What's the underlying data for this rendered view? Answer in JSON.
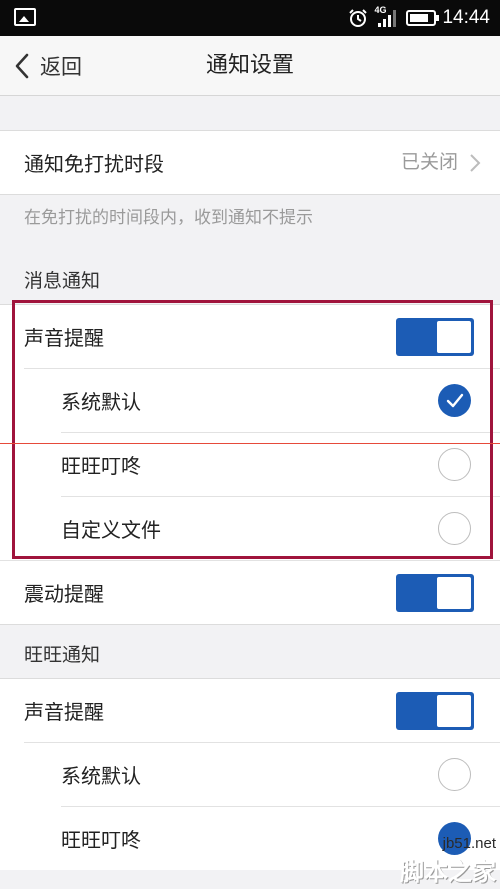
{
  "status_bar": {
    "time": "14:44",
    "network": "4G"
  },
  "nav": {
    "back_label": "返回",
    "title": "通知设置"
  },
  "dnd": {
    "label": "通知免打扰时段",
    "value": "已关闭",
    "note": "在免打扰的时间段内，收到通知不提示"
  },
  "message_section": {
    "header": "消息通知",
    "sound": {
      "label": "声音提醒",
      "on": true
    },
    "options": [
      {
        "label": "系统默认",
        "selected": true
      },
      {
        "label": "旺旺叮咚",
        "selected": false
      },
      {
        "label": "自定义文件",
        "selected": false
      }
    ],
    "vibrate": {
      "label": "震动提醒",
      "on": true
    }
  },
  "wangwang_section": {
    "header": "旺旺通知",
    "sound": {
      "label": "声音提醒",
      "on": true
    },
    "options": [
      {
        "label": "系统默认",
        "selected": false
      },
      {
        "label": "旺旺叮咚",
        "selected": true
      }
    ]
  },
  "watermark": {
    "site": "jb51.net",
    "name": "脚本之家"
  },
  "colors": {
    "accent": "#1c5cb5",
    "highlight": "#a0143c",
    "background": "#f2f2f4"
  }
}
